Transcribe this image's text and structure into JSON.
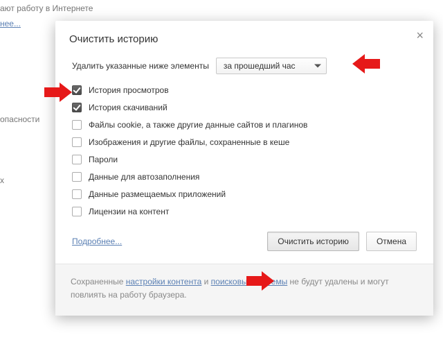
{
  "background": {
    "line1": "ают работу в Интернете",
    "link1": "нее...",
    "label_security": "опасности",
    "label_x": "x"
  },
  "dialog": {
    "title": "Очистить историю",
    "prompt": "Удалить указанные ниже элементы",
    "select_value": "за прошедший час",
    "items": [
      {
        "label": "История просмотров",
        "checked": true
      },
      {
        "label": "История скачиваний",
        "checked": true
      },
      {
        "label": "Файлы cookie, а также другие данные сайтов и плагинов",
        "checked": false
      },
      {
        "label": "Изображения и другие файлы, сохраненные в кеше",
        "checked": false
      },
      {
        "label": "Пароли",
        "checked": false
      },
      {
        "label": "Данные для автозаполнения",
        "checked": false
      },
      {
        "label": "Данные размещаемых приложений",
        "checked": false
      },
      {
        "label": "Лицензии на контент",
        "checked": false
      }
    ],
    "more_link": "Подробнее...",
    "btn_clear": "Очистить историю",
    "btn_cancel": "Отмена",
    "close_icon": "×"
  },
  "footer": {
    "t1": "Сохраненные ",
    "link1": "настройки контента",
    "t2": " и ",
    "link2": "поисковые системы",
    "t3": " не будут удалены и могут повлиять на работу браузера."
  }
}
